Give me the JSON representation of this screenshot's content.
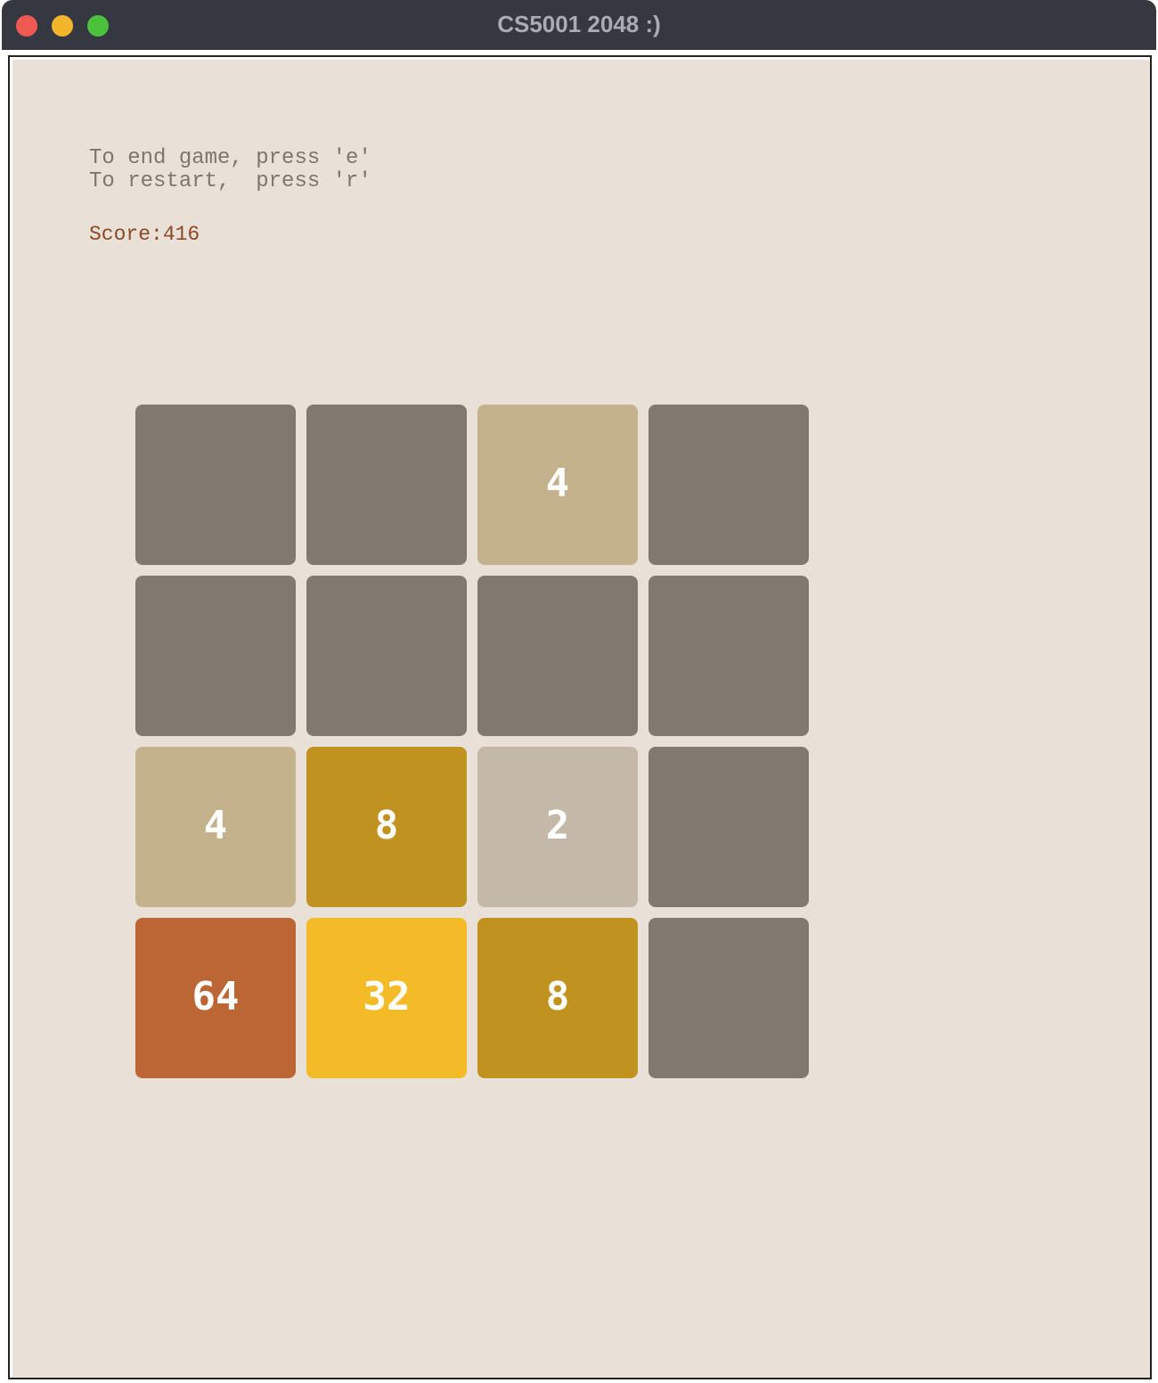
{
  "window": {
    "title": "CS5001 2048 :)"
  },
  "instructions": {
    "line1": "To end game, press 'e'",
    "line2": "To restart,  press 'r'"
  },
  "score": {
    "text": "Score:416"
  },
  "board": {
    "rows": [
      [
        "",
        "",
        "4",
        ""
      ],
      [
        "",
        "",
        "",
        ""
      ],
      [
        "4",
        "8",
        "2",
        ""
      ],
      [
        "64",
        "32",
        "8",
        ""
      ]
    ]
  },
  "colors": {
    "empty": "#807970",
    "2": "#c4b9a8",
    "4": "#c3b28b",
    "8": "#c0921f",
    "32": "#f3bb27",
    "64": "#bc6535",
    "background": "#e9e1d8",
    "instruction_text": "#7d766e",
    "score_text": "#8b4a25",
    "titlebar": "#353840"
  }
}
